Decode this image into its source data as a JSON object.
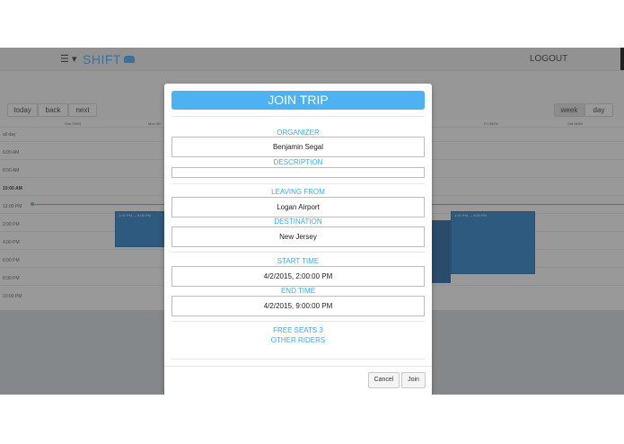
{
  "header": {
    "menu_icon": "hamburger-icon",
    "menu_caret": "▾",
    "brand_text": "SHIFT",
    "brand_icon": "car-icon",
    "logout_label": "LOGOUT"
  },
  "calendar": {
    "buttons": {
      "today": "today",
      "back": "back",
      "next": "next",
      "week": "week",
      "day": "day"
    },
    "columns": [
      "Sun 29/03",
      "Mon 30/",
      "Fri 03/04",
      "Sat 04/04"
    ],
    "times": [
      "all day",
      "6:00 AM",
      "8:00 AM",
      "10:00 AM",
      "12:00 PM",
      "2:00 PM",
      "4:00 PM",
      "6:00 PM",
      "8:00 PM",
      "10:00 PM"
    ],
    "events": [
      "1:00 PM — 8:00 PM",
      "1:00 PM — 8:00 PM"
    ]
  },
  "modal": {
    "title": "JOIN TRIP",
    "organizer_label": "ORGANIZER",
    "organizer_value": "Benjamin Segal",
    "description_label": "DESCRIPTION",
    "description_value": "",
    "leaving_from_label": "LEAVING FROM",
    "leaving_from_value": "Logan Airport",
    "destination_label": "DESTINATION",
    "destination_value": "New Jersey",
    "start_time_label": "START TIME",
    "start_time_value": "4/2/2015, 2:00:00 PM",
    "end_time_label": "END TIME",
    "end_time_value": "4/2/2015, 9:00:00 PM",
    "free_seats_label": "FREE SEATS 3",
    "other_riders_label": "OTHER RIDERS",
    "cancel_label": "Cancel",
    "join_label": "Join"
  },
  "colors": {
    "accent": "#3fa9f5",
    "title_bar": "#4eb1f1",
    "event": "#1f78c0"
  }
}
